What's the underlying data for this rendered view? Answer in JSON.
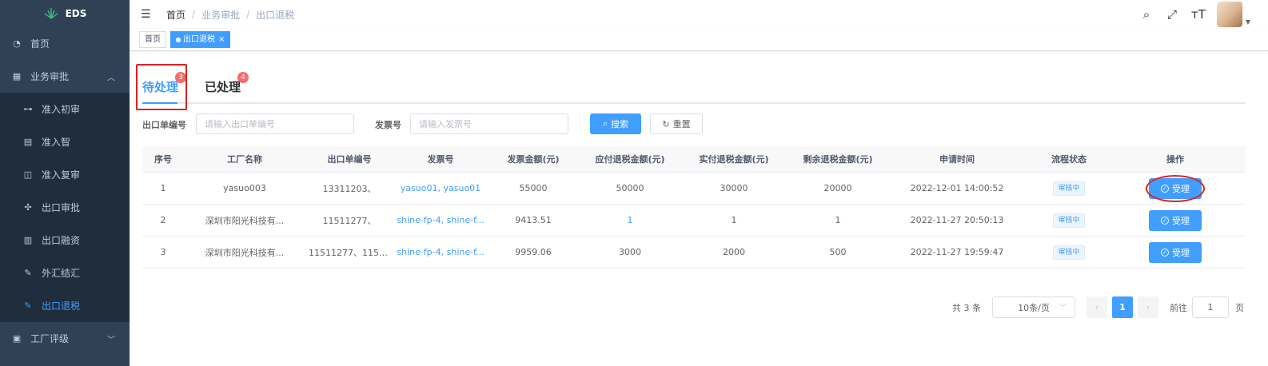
{
  "sidebar": {
    "brand": "EDS",
    "items": [
      {
        "label": "首页",
        "icon": "dashboard-icon"
      },
      {
        "label": "业务审批",
        "icon": "table-icon",
        "expanded": true
      }
    ],
    "submenu": [
      {
        "label": "准入初审",
        "icon": "tree-icon"
      },
      {
        "label": "准入智",
        "icon": "form-icon"
      },
      {
        "label": "准入复审",
        "icon": "book-icon"
      },
      {
        "label": "出口审批",
        "icon": "guide-icon"
      },
      {
        "label": "出口融资",
        "icon": "nested-icon"
      },
      {
        "label": "外汇结汇",
        "icon": "edit-icon"
      },
      {
        "label": "出口退税",
        "icon": "edit-icon",
        "active": true
      }
    ],
    "bottom_item": {
      "label": "工厂评级",
      "icon": "list-icon"
    }
  },
  "header": {
    "breadcrumb": [
      "首页",
      "业务审批",
      "出口退税"
    ]
  },
  "tags": [
    {
      "label": "首页",
      "active": false
    },
    {
      "label": "出口退税",
      "active": true
    }
  ],
  "tabs": [
    {
      "label": "待处理",
      "badge": "3",
      "active": true
    },
    {
      "label": "已处理",
      "badge": "4",
      "active": false
    }
  ],
  "search": {
    "order_label": "出口单编号",
    "order_placeholder": "请输入出口单编号",
    "invoice_label": "发票号",
    "invoice_placeholder": "请输入发票号",
    "search_button": "搜索",
    "reset_button": "重置"
  },
  "table": {
    "columns": [
      "序号",
      "工厂名称",
      "出口单编号",
      "发票号",
      "发票金额(元)",
      "应付退税金额(元)",
      "实付退税金额(元)",
      "剩余退税金额(元)",
      "申请时间",
      "流程状态",
      "操作"
    ],
    "rows": [
      [
        "1",
        "yasuo003",
        "13311203、",
        "yasuo01, yasuo01",
        "55000",
        "50000",
        "30000",
        "20000",
        "2022-12-01 14:00:52",
        "审核中",
        "受理"
      ],
      [
        "2",
        "深圳市阳光科技有...",
        "11511277、",
        "shine-fp-4, shine-f...",
        "9413.51",
        "1",
        "1",
        "1",
        "2022-11-27 20:50:13",
        "审核中",
        "受理"
      ],
      [
        "3",
        "深圳市阳光科技有...",
        "11511277、11511...",
        "shine-fp-4, shine-f...",
        "9959.06",
        "3000",
        "2000",
        "500",
        "2022-11-27 19:59:47",
        "审核中",
        "受理"
      ]
    ]
  },
  "pagination": {
    "total": "共 3 条",
    "page_size": "10条/页",
    "current_page": "1",
    "goto_label": "前往",
    "goto_value": "1",
    "page_unit": "页"
  }
}
